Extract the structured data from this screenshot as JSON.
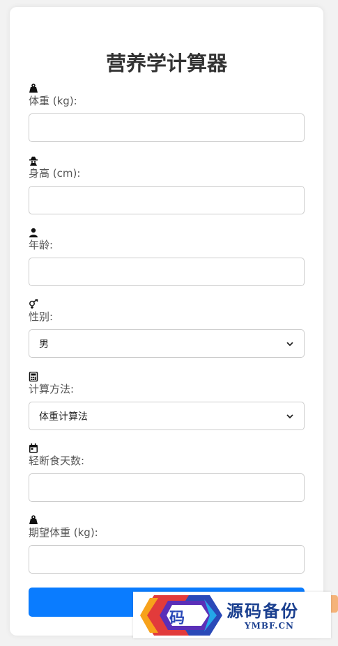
{
  "title": "营养学计算器",
  "fields": [
    {
      "icon": "weight-icon",
      "label": "体重 (kg):",
      "type": "input",
      "value": ""
    },
    {
      "icon": "user-secret-icon",
      "label": "身高 (cm):",
      "type": "input",
      "value": ""
    },
    {
      "icon": "user-icon",
      "label": "年龄:",
      "type": "input",
      "value": ""
    },
    {
      "icon": "venus-mars-icon",
      "label": "性别:",
      "type": "select",
      "value": "男"
    },
    {
      "icon": "calculator-icon",
      "label": "计算方法:",
      "type": "select",
      "value": "体重计算法"
    },
    {
      "icon": "calendar-icon",
      "label": "轻断食天数:",
      "type": "input",
      "value": ""
    },
    {
      "icon": "weight-icon",
      "label": "期望体重 (kg):",
      "type": "input",
      "value": ""
    }
  ],
  "submit_button": {
    "label": "",
    "color": "#0a7cff"
  },
  "watermark": {
    "logo_char": "码",
    "name": "源码备份",
    "domain": "YMBF.CN"
  }
}
